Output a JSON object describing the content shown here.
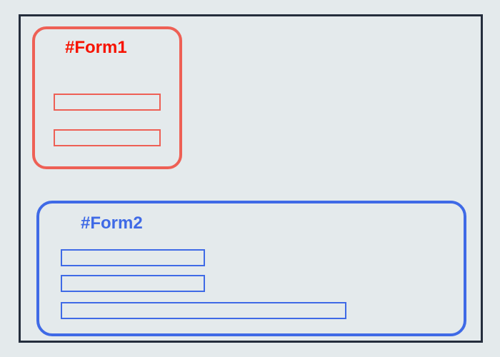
{
  "form1": {
    "label": "#Form1",
    "color": "#ee6055",
    "inputs": [
      {
        "value": "",
        "placeholder": ""
      },
      {
        "value": "",
        "placeholder": ""
      }
    ]
  },
  "form2": {
    "label": "#Form2",
    "color": "#3f6ae6",
    "inputs": [
      {
        "value": "",
        "placeholder": ""
      },
      {
        "value": "",
        "placeholder": ""
      },
      {
        "value": "",
        "placeholder": ""
      }
    ]
  }
}
